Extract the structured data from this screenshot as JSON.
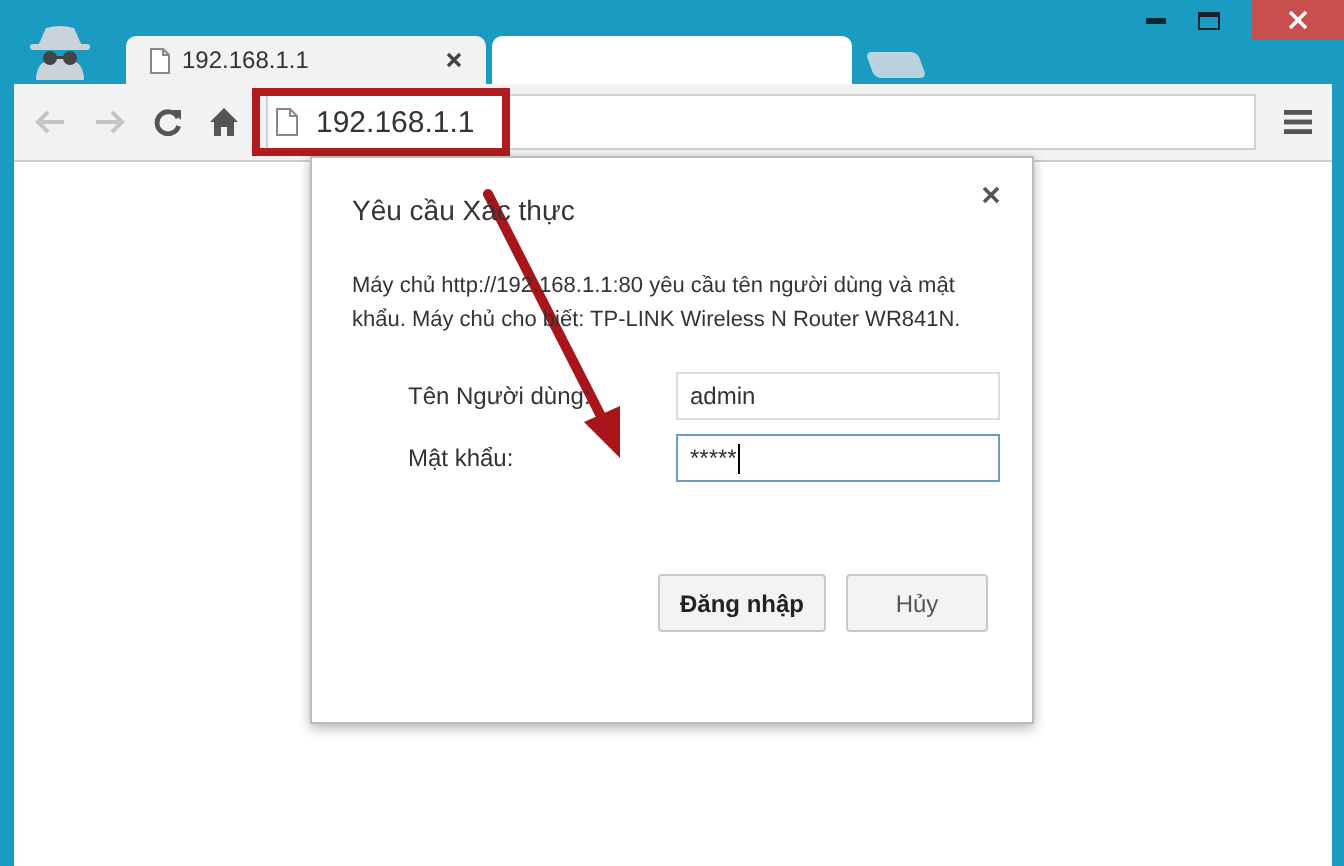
{
  "tabs": [
    {
      "title": "192.168.1.1",
      "selected": true,
      "closable": true
    },
    {
      "selected": false,
      "closable": false
    }
  ],
  "address_bar": {
    "url": "192.168.1.1",
    "highlighted": true
  },
  "dialog": {
    "title": "Yêu cầu Xác thực",
    "message": "Máy chủ http://192.168.1.1:80 yêu cầu tên người dùng và mật khẩu. Máy chủ cho biết: TP-LINK Wireless N Router WR841N.",
    "fields": [
      {
        "label": "Tên Người dùng:",
        "value": "admin",
        "focused": false
      },
      {
        "label": "Mật khẩu:",
        "value": "*****",
        "focused": true
      }
    ],
    "buttons": [
      {
        "label": "Đăng nhập",
        "primary": true
      },
      {
        "label": "Hủy",
        "primary": false
      }
    ]
  }
}
